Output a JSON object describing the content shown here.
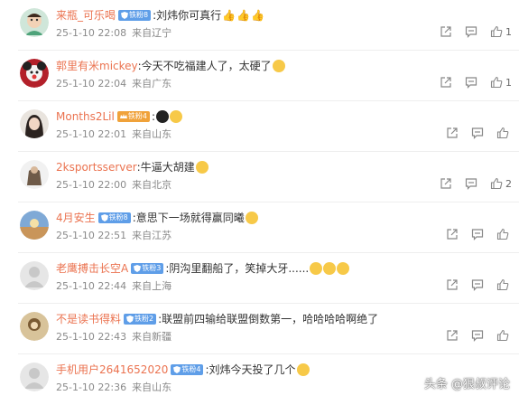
{
  "comments": [
    {
      "user": "来瓶_可乐喝",
      "badge": "铁粉8",
      "text": ":刘炜你可真行",
      "date": "25-1-10 22:08",
      "loc": "来自辽宁",
      "likes": "1"
    },
    {
      "user": "郭里有米mickey",
      "badge": "",
      "text": ":今天不吃福建人了，太硬了",
      "date": "25-1-10 22:04",
      "loc": "来自广东",
      "likes": "1"
    },
    {
      "user": "Months2Lil",
      "badge": "铁粉4",
      "text": ":",
      "date": "25-1-10 22:01",
      "loc": "来自山东",
      "likes": ""
    },
    {
      "user": "2ksportsserver",
      "badge": "",
      "text": ":牛逼大胡建",
      "date": "25-1-10 22:00",
      "loc": "来自北京",
      "likes": "2"
    },
    {
      "user": "4月安生",
      "badge": "铁粉8",
      "text": ":意思下一场就得赢同曦",
      "date": "25-1-10 22:51",
      "loc": "来自江苏",
      "likes": ""
    },
    {
      "user": "老鹰搏击长空A",
      "badge": "铁粉3",
      "text": ":阴沟里翻船了，笑掉大牙......",
      "date": "25-1-10 22:44",
      "loc": "来自上海",
      "likes": ""
    },
    {
      "user": "不是读书得料",
      "badge": "铁粉2",
      "text": ":联盟前四输给联盟倒数第一，哈哈哈哈啊绝了",
      "date": "25-1-10 22:43",
      "loc": "来自新疆",
      "likes": ""
    },
    {
      "user": "手机用户2641652020",
      "badge": "铁粉4",
      "text": ":刘炜今天投了几个",
      "date": "25-1-10 22:36",
      "loc": "来自山东",
      "likes": ""
    }
  ],
  "watermark": "头条 @狠叔评论",
  "colors": {
    "username": "#eb7350",
    "badge": "#5f9ee8",
    "meta": "#8a8a8a"
  }
}
